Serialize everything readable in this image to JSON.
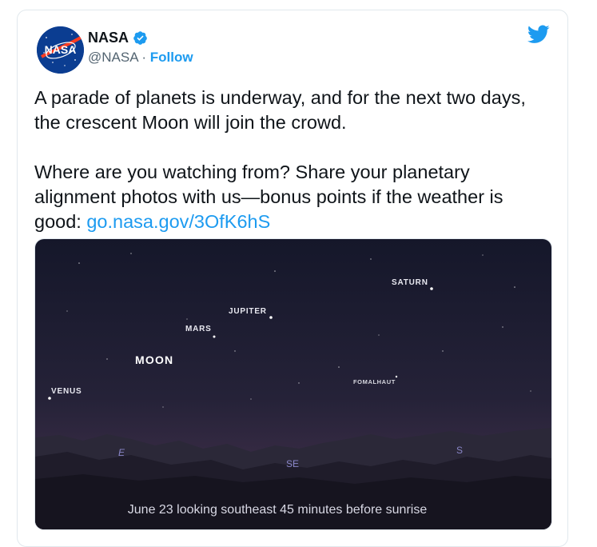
{
  "author": {
    "name": "NASA",
    "handle": "@NASA",
    "separator": "·",
    "follow_label": "Follow",
    "logo_text": "NASA"
  },
  "tweet": {
    "line1": "A parade of planets is underway, and for the next two days, the crescent Moon will join the crowd.",
    "line2_prefix": "Where are you watching from? Share your planetary alignment photos with us—bonus points if the weather is good: ",
    "link": "go.nasa.gov/3OfK6hS"
  },
  "media": {
    "labels": {
      "saturn": "SATURN",
      "jupiter": "JUPITER",
      "mars": "MARS",
      "moon": "MOON",
      "venus": "VENUS",
      "fomalhaut": "FOMALHAUT"
    },
    "directions": {
      "east": "E",
      "southeast": "SE",
      "south": "S"
    },
    "caption": "June 23 looking southeast 45 minutes before sunrise"
  },
  "icons": {
    "twitter": "twitter-bird-icon",
    "verified": "verified-badge-icon"
  },
  "colors": {
    "accent": "#1d9bf0",
    "sky_top": "#16182a",
    "sky_bottom": "#3a2b4a"
  }
}
